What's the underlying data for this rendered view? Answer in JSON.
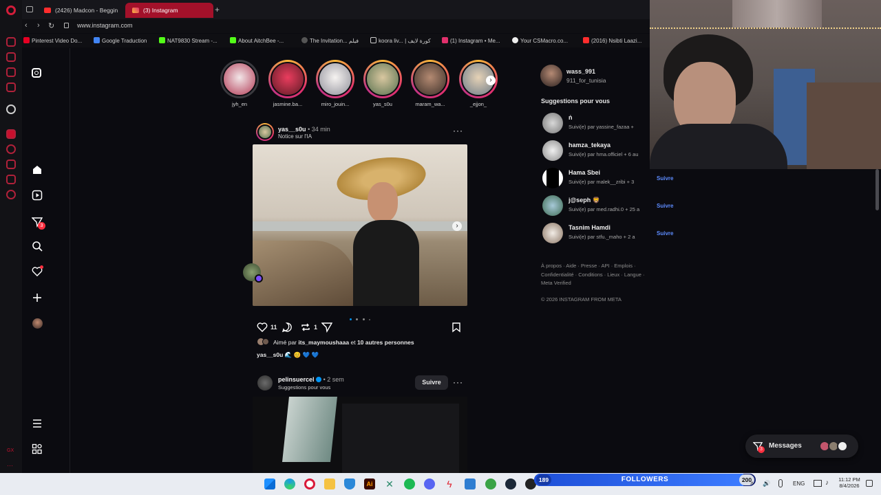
{
  "tabs": [
    {
      "label": "(2426) Madcon - Beggin",
      "active": false
    },
    {
      "label": "(3) Instagram",
      "active": true
    }
  ],
  "address": {
    "url": "www.instagram.com"
  },
  "bookmarks": [
    "Pinterest Video Do...",
    "Google Traduction",
    "NAT9830 Stream -...",
    "About AitchBee -...",
    "The Invitation... فيلم",
    "koora liv... | كورة لايف",
    "(1) Instagram • Me...",
    "Your CSMacro.co...",
    "(2016) Nsibti Laazi..."
  ],
  "sidebar": {
    "notifications_badge": "3"
  },
  "stories": [
    {
      "username": "jyh_en",
      "seen": true
    },
    {
      "username": "jasmine.ba...",
      "seen": false
    },
    {
      "username": "miro_jouin...",
      "seen": false
    },
    {
      "username": "yas_s0u",
      "seen": false
    },
    {
      "username": "maram_wa...",
      "seen": false
    },
    {
      "username": "_ejjon_",
      "seen": false
    }
  ],
  "post1": {
    "username": "yas__s0u",
    "time": "• 34 min",
    "subtitle": "Notice sur l'IA",
    "likes": "11",
    "comments": "",
    "reposts": "1",
    "liked_by_prefix": "Aimé par",
    "liked_by_user": "its_maymoushaaa",
    "liked_by_mid": "et",
    "liked_by_rest": "10 autres personnes",
    "caption_user": "yas__s0u",
    "caption_emoji": "🌊 😊 💙 💙"
  },
  "post2": {
    "username": "pelinsuercel",
    "time": "• 2 sem",
    "subtitle": "Suggestions pour vous",
    "follow_label": "Suivre"
  },
  "profile": {
    "username": "wass_991",
    "fullname": "911_for_tunisia"
  },
  "suggestions_title": "Suggestions pour vous",
  "suggestions": [
    {
      "name": "ṅ",
      "sub": "Suivi(e) par yassine_fazaa +",
      "follow": ""
    },
    {
      "name": "hamza_tekaya",
      "sub": "Suivi(e) par hma.officiel + 6 au",
      "follow": ""
    },
    {
      "name": "Hama Sbei",
      "sub": "Suivi(e) par malek__zribi + 3",
      "follow": "Suivre"
    },
    {
      "name": "j@seph 🦁",
      "sub": "Suivi(e) par med.radhi.0 + 25 a",
      "follow": "Suivre"
    },
    {
      "name": "Tasnim Hamdi",
      "sub": "Suivi(e) par stfu._maho + 2 a",
      "follow": "Suivre"
    }
  ],
  "footer_links": "À propos · Aide · Presse · API · Emplois · Confidentialité · Conditions · Lieux · Langue · Meta Verified",
  "copyright": "© 2026 INSTAGRAM FROM META",
  "messages_label": "Messages",
  "messages_badge": "3",
  "taskbar": {
    "followers_label": "FOLLOWERS",
    "followers_left": "189",
    "followers_right": "200",
    "followers_progress": 0.945,
    "lang": "ENG",
    "time": "11:12 PM",
    "date": "8/4/2026"
  },
  "colors": {
    "accent_opera": "#c8102e",
    "instagram_blue": "#0095f6"
  }
}
